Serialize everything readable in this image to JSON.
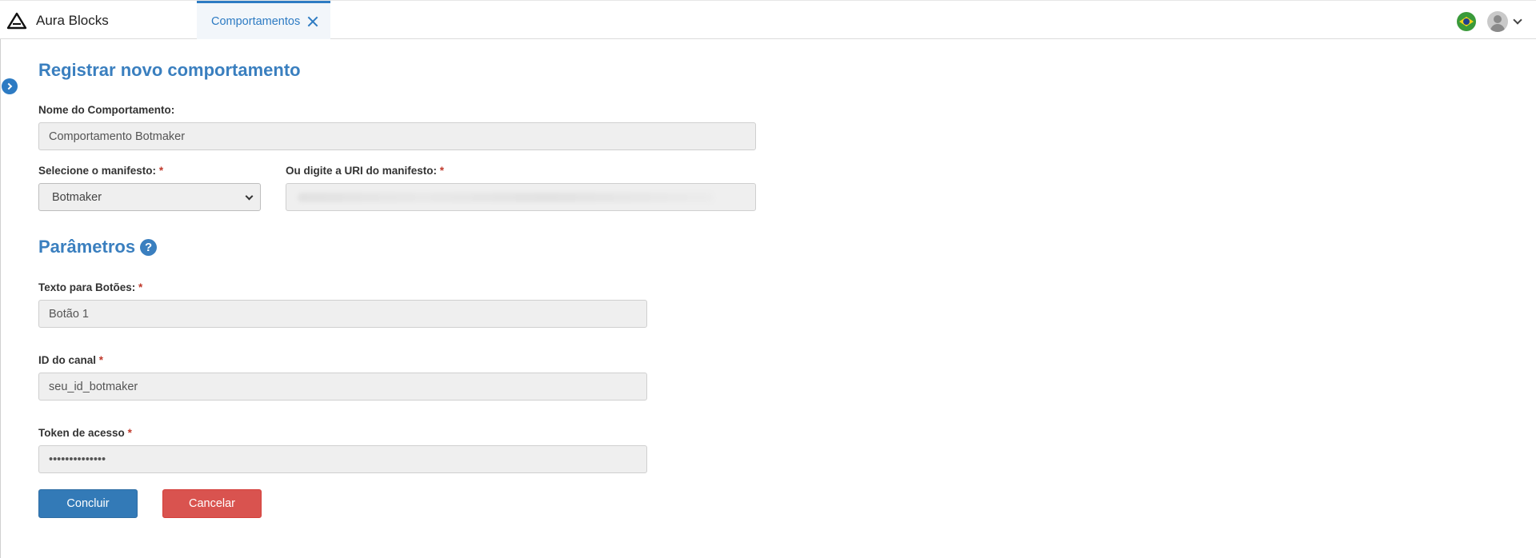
{
  "app": {
    "brand_name": "Aura Blocks",
    "logo_icon": "aura-triangle-logo"
  },
  "tabs": [
    {
      "label": "Comportamentos",
      "active": true
    }
  ],
  "header": {
    "language_flag_icon": "brazil-flag-icon",
    "user_icon": "avatar-icon"
  },
  "page": {
    "title": "Registrar novo comportamento"
  },
  "form": {
    "name": {
      "label": "Nome do Comportamento:",
      "value": "Comportamento Botmaker"
    },
    "manifest_select": {
      "label": "Selecione o manifesto:",
      "required_mark": "*",
      "selected": "Botmaker"
    },
    "manifest_uri": {
      "label": "Ou digite a URI do manifesto:",
      "required_mark": "*",
      "value_obscured": true
    }
  },
  "parameters": {
    "title": "Parâmetros",
    "help_icon_glyph": "?",
    "button_text": {
      "label": "Texto para Botões:",
      "required_mark": "*",
      "value": "Botão 1"
    },
    "channel_id": {
      "label": "ID do canal",
      "required_mark": "*",
      "value": "seu_id_botmaker"
    },
    "access_token": {
      "label": "Token de acesso",
      "required_mark": "*",
      "value": "••••••••••••••"
    }
  },
  "actions": {
    "submit_label": "Concluir",
    "cancel_label": "Cancelar"
  },
  "colors": {
    "accent": "#3a7fbf",
    "primary_button": "#337ab7",
    "danger_button": "#d9534f",
    "required": "#c0392b"
  }
}
